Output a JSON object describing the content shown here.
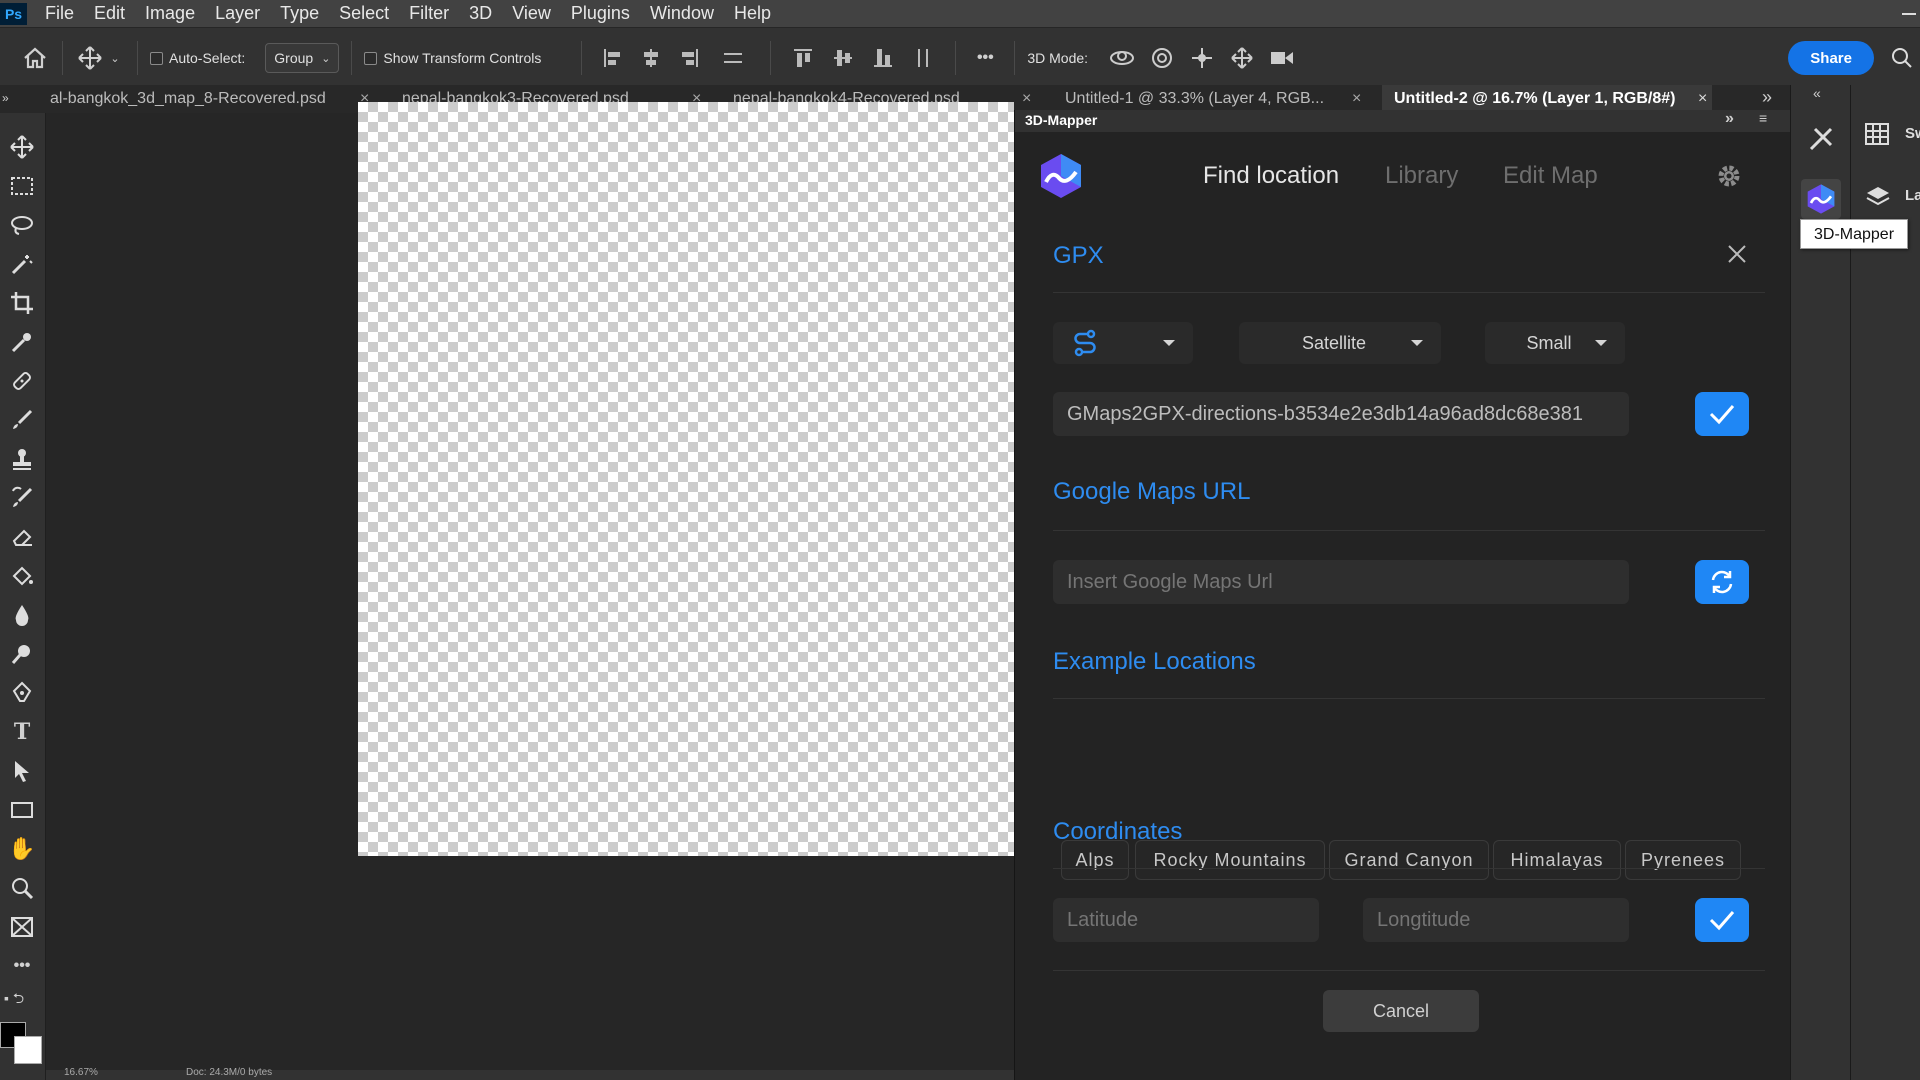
{
  "app": {
    "logo": "Ps"
  },
  "menu": [
    "File",
    "Edit",
    "Image",
    "Layer",
    "Type",
    "Select",
    "Filter",
    "3D",
    "View",
    "Plugins",
    "Window",
    "Help"
  ],
  "options": {
    "auto_select_label": "Auto-Select:",
    "group_value": "Group",
    "transform_label": "Show Transform Controls",
    "mode_3d_label": "3D Mode:",
    "share_label": "Share",
    "more_label": "•••"
  },
  "tabs": [
    {
      "label": "al-bangkok_3d_map_8-Recovered.psd"
    },
    {
      "label": "nepal-bangkok3-Recovered.psd"
    },
    {
      "label": "nepal-bangkok4-Recovered.psd"
    },
    {
      "label": "Untitled-1 @ 33.3% (Layer 4, RGB..."
    },
    {
      "label": "Untitled-2 @ 16.7% (Layer 1, RGB/8#)",
      "active": true
    }
  ],
  "panel": {
    "title": "3D-Mapper",
    "nav": {
      "find": "Find location",
      "library": "Library",
      "edit": "Edit Map"
    },
    "gpx": {
      "title": "GPX",
      "map_type": "Satellite",
      "size": "Small",
      "file_value": "GMaps2GPX-directions-b3534e2e3db14a96ad8dc68e381"
    },
    "google": {
      "title": "Google Maps URL",
      "placeholder": "Insert Google Maps Url"
    },
    "examples": {
      "title": "Example Locations",
      "items": [
        "Alps",
        "Rocky Mountains",
        "Grand Canyon",
        "Himalayas",
        "Pyrenees"
      ]
    },
    "coords": {
      "title": "Coordinates",
      "lat_placeholder": "Latitude",
      "lng_placeholder": "Longtitude"
    },
    "cancel_label": "Cancel"
  },
  "dock": {
    "tooltip": "3D-Mapper",
    "label1": "Sw",
    "label2": "La"
  },
  "status": {
    "zoom": "16.67%",
    "doc": "Doc: 24.3M/0 bytes"
  },
  "colors": {
    "accent": "#1f87f5",
    "section_title": "#2e8cf0",
    "share": "#1473e6"
  }
}
